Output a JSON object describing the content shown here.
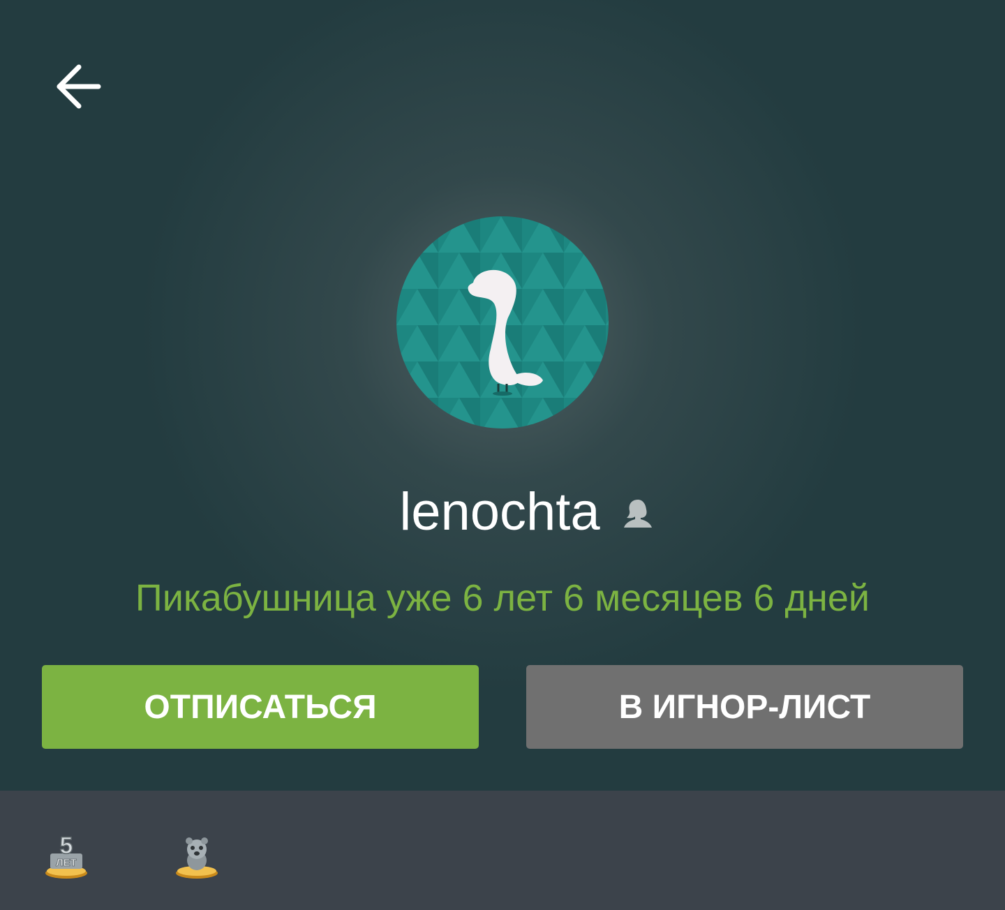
{
  "header": {
    "back_icon": "arrow-left-icon"
  },
  "profile": {
    "username": "lenochta",
    "gender_icon": "female-profile-icon",
    "status": "Пикабушница уже 6 лет 6 месяцев 6 дней"
  },
  "actions": {
    "unsubscribe_label": "ОТПИСАТЬСЯ",
    "ignore_label": "В ИГНОР-ЛИСТ"
  },
  "awards": {
    "items": [
      {
        "icon": "five-years-award-icon",
        "number": "5",
        "caption": "ЛЕТ"
      },
      {
        "icon": "animal-award-icon"
      }
    ]
  },
  "colors": {
    "accent_green": "#7cb342",
    "header_bg": "#233c40",
    "awards_bg": "#3c434b",
    "button_gray": "#707070",
    "avatar_teal": "#1f8a84"
  }
}
